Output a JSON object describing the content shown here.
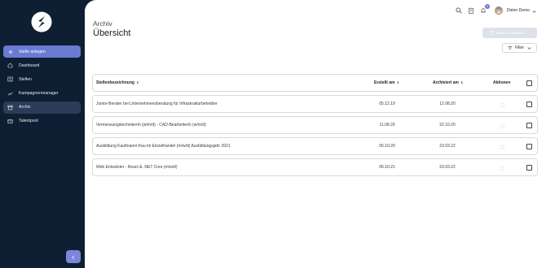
{
  "sidebar": {
    "items": [
      {
        "label": "Stelle anlegen",
        "icon": "plus-icon"
      },
      {
        "label": "Dashboard",
        "icon": "home-icon"
      },
      {
        "label": "Stellen",
        "icon": "list-icon"
      },
      {
        "label": "Kampagnenmanager",
        "icon": "chart-icon"
      },
      {
        "label": "Archiv",
        "icon": "archive-icon"
      },
      {
        "label": "Talentpool",
        "icon": "cards-icon"
      }
    ],
    "collapse_icon": "chevron-left-icon"
  },
  "topbar": {
    "notification_count": "0",
    "user_name": "Dieter Demo"
  },
  "page": {
    "breadcrumb": "Archiv",
    "title": "Übersicht",
    "archive_button": "Stelle archivieren",
    "filter_button": "Filter"
  },
  "table": {
    "headers": {
      "name": "Stellenbezeichnung",
      "created": "Erstellt am",
      "archived": "Archiviert am",
      "actions": "Aktionen"
    },
    "rows": [
      {
        "name": "Junior-Berater bei Unternehmensberatung für Infrastrukturbetreiber",
        "created": "05.12.19",
        "archived": "12.08.20"
      },
      {
        "name": "VermessungstechnikerIn (w/m/d) - CAD-BearbeiterIn (w/m/d)",
        "created": "11.08.20",
        "archived": "22.10.20"
      },
      {
        "name": "Ausbildung Kaufmann/-frau im Einzelhandel (m/w/d) Ausbildungsjahr 2021",
        "created": "05.10.20",
        "archived": "23.03.22"
      },
      {
        "name": "Web Entwickler - React & .NET Core (m/w/d)",
        "created": "06.10.21",
        "archived": "23.03.22"
      }
    ]
  },
  "colors": {
    "sidebar_bg": "#0f1f33",
    "primary": "#6a7bd3",
    "active_item": "#2a3c58"
  }
}
